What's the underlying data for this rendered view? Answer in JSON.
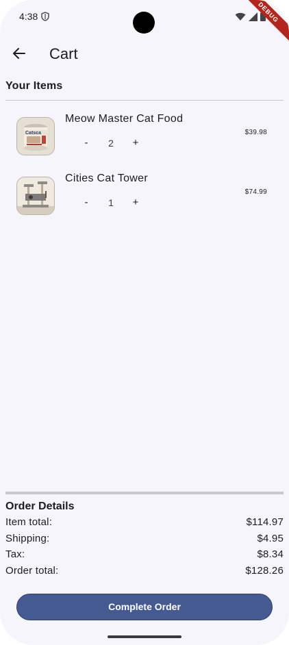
{
  "status_bar": {
    "time": "4:38",
    "debug_label": "DEBUG"
  },
  "app_bar": {
    "title": "Cart"
  },
  "items_section": {
    "heading": "Your Items"
  },
  "cart_items": [
    {
      "name": "Meow Master Cat Food",
      "quantity": "2",
      "price": "$39.98",
      "minus_label": "-",
      "plus_label": "+",
      "thumb_label": "Catsca"
    },
    {
      "name": "Cities Cat Tower",
      "quantity": "1",
      "price": "$74.99",
      "minus_label": "-",
      "plus_label": "+"
    }
  ],
  "order_details": {
    "heading": "Order Details",
    "rows": [
      {
        "label": "Item total:",
        "value": "$114.97"
      },
      {
        "label": "Shipping:",
        "value": "$4.95"
      },
      {
        "label": "Tax:",
        "value": "$8.34"
      },
      {
        "label": "Order total:",
        "value": "$128.26"
      }
    ]
  },
  "actions": {
    "complete_label": "Complete Order"
  },
  "colors": {
    "background": "#f7f5fc",
    "primary_button": "#455a91",
    "debug_banner": "#b3261e"
  }
}
